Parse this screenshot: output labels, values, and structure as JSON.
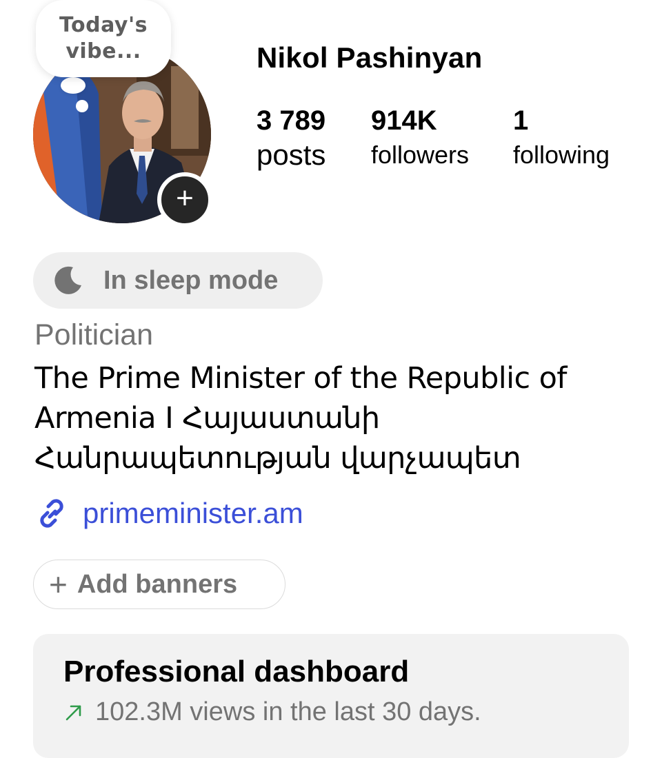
{
  "note": {
    "text": "Today's\nvibe..."
  },
  "profile": {
    "username": "Nikol Pashinyan",
    "stats": [
      {
        "value": "3 789",
        "label": "posts"
      },
      {
        "value": "914K",
        "label": "followers"
      },
      {
        "value": "1",
        "label": "following"
      }
    ]
  },
  "sleep_mode": {
    "label": "In sleep mode",
    "icon": "moon-icon"
  },
  "bio": {
    "category": "Politician",
    "lines": [
      "The Prime Minister of the Republic of",
      "Armenia I Հայաստանի",
      "Հանրապետության վարչապետ"
    ]
  },
  "link": {
    "text": "primeminister.am",
    "icon": "link-icon",
    "color": "#3b4fd8"
  },
  "banners": {
    "label": "Add banners",
    "icon": "plus-icon"
  },
  "dashboard": {
    "title": "Professional dashboard",
    "subtitle": "102.3M views in the last 30 days.",
    "icon": "trend-up-icon",
    "trend_color": "#2e9b4a"
  },
  "colors": {
    "muted": "#737373",
    "pill_bg": "#efefef",
    "dashboard_bg": "#f2f2f2"
  }
}
